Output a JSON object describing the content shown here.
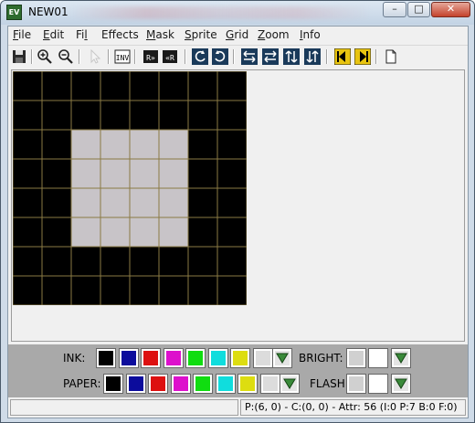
{
  "window": {
    "title": "NEW01",
    "minimize_glyph": "–",
    "maximize_glyph": "□",
    "close_glyph": "✕"
  },
  "menu": {
    "items": [
      {
        "label": "File",
        "mnemonic": "F",
        "rest": "ile"
      },
      {
        "label": "Edit",
        "mnemonic": "E",
        "rest": "dit"
      },
      {
        "label": "Fill",
        "mnemonic": "",
        "rest": "Fi",
        "mnemonic_after": "l",
        "tail": "l"
      },
      {
        "label": "Effects",
        "mnemonic": "",
        "rest": "Effects"
      },
      {
        "label": "Mask",
        "mnemonic": "M",
        "rest": "ask"
      },
      {
        "label": "Sprite",
        "mnemonic": "S",
        "rest": "prite"
      },
      {
        "label": "Grid",
        "mnemonic": "G",
        "rest": "rid"
      },
      {
        "label": "Zoom",
        "mnemonic": "Z",
        "rest": "oom"
      },
      {
        "label": "Info",
        "mnemonic": "I",
        "rest": "nfo"
      }
    ]
  },
  "toolbar": {
    "buttons": [
      {
        "name": "save-icon"
      },
      {
        "name": "zoom-in-icon"
      },
      {
        "name": "zoom-out-icon"
      },
      {
        "name": "select-arrow-icon"
      },
      {
        "name": "invert-icon",
        "text": "INV"
      },
      {
        "name": "shift-right-icon",
        "text": "R»"
      },
      {
        "name": "shift-left-icon",
        "text": "«R"
      },
      {
        "name": "rotate-left-icon"
      },
      {
        "name": "rotate-right-icon"
      },
      {
        "name": "flip-horizontal-icon"
      },
      {
        "name": "flip-horizontal-2-icon"
      },
      {
        "name": "flip-vertical-icon"
      },
      {
        "name": "flip-vertical-2-icon"
      },
      {
        "name": "previous-frame-icon"
      },
      {
        "name": "next-frame-icon"
      },
      {
        "name": "new-document-icon"
      }
    ]
  },
  "sprite": {
    "cols": 8,
    "rows": 8,
    "ink_color": "#000000",
    "paper_color": "#c8c4c8",
    "grid_color": "#8a7a44",
    "pixels": [
      "11111111",
      "11111111",
      "11000011",
      "11000011",
      "11000011",
      "11000011",
      "11111111",
      "11111111"
    ]
  },
  "palette": {
    "colors": [
      "#000000",
      "#0c0c9c",
      "#dd1010",
      "#dd10cc",
      "#10dd10",
      "#10dddd",
      "#dddd10",
      "#dcdcdc"
    ],
    "ink_label": "INK:",
    "paper_label": "PAPER:",
    "bright_label": "BRIGHT:",
    "flash_label": "FLASH:"
  },
  "status": {
    "left": "",
    "right": "P:(6, 0) - C:(0, 0) - Attr: 56 (I:0 P:7 B:0 F:0)"
  }
}
